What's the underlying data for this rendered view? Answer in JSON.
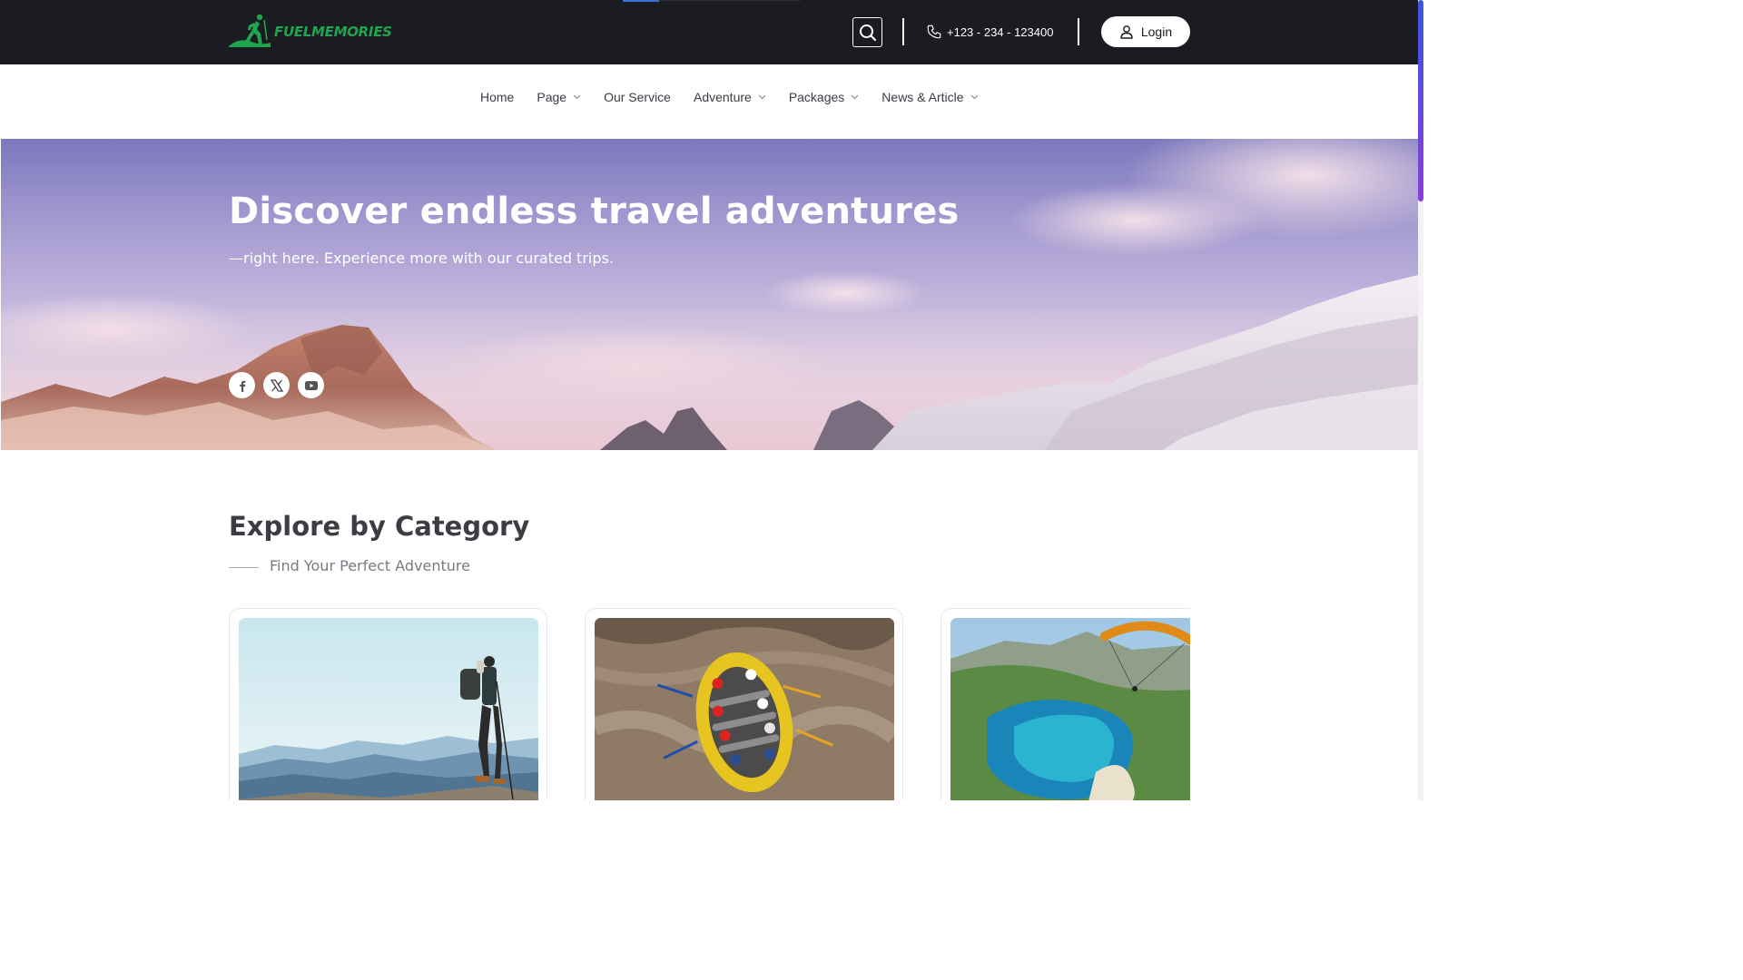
{
  "brand": {
    "name": "FUELMEMORIES",
    "logo_icon": "hiker-icon"
  },
  "header": {
    "search_icon": "search-icon",
    "phone_icon": "phone-icon",
    "phone": "+123 - 234 - 123400",
    "login_label": "Login",
    "login_icon": "user-icon"
  },
  "nav": {
    "items": [
      {
        "label": "Home",
        "dropdown": false
      },
      {
        "label": "Page",
        "dropdown": true
      },
      {
        "label": "Our Service",
        "dropdown": false
      },
      {
        "label": "Adventure",
        "dropdown": true
      },
      {
        "label": "Packages",
        "dropdown": true
      },
      {
        "label": "News & Article",
        "dropdown": true
      }
    ]
  },
  "hero": {
    "title": "Discover endless travel adventures",
    "subtitle": "—right here. Experience more with our curated trips.",
    "socials": [
      "facebook-icon",
      "x-twitter-icon",
      "youtube-icon"
    ]
  },
  "category": {
    "title": "Explore by Category",
    "subtitle": "Find Your Perfect Adventure"
  },
  "colors": {
    "topbar": "#1b1b22",
    "brand_green": "#1fa54f",
    "text_dark": "#3c3c44",
    "text_muted": "#7a7a84"
  }
}
